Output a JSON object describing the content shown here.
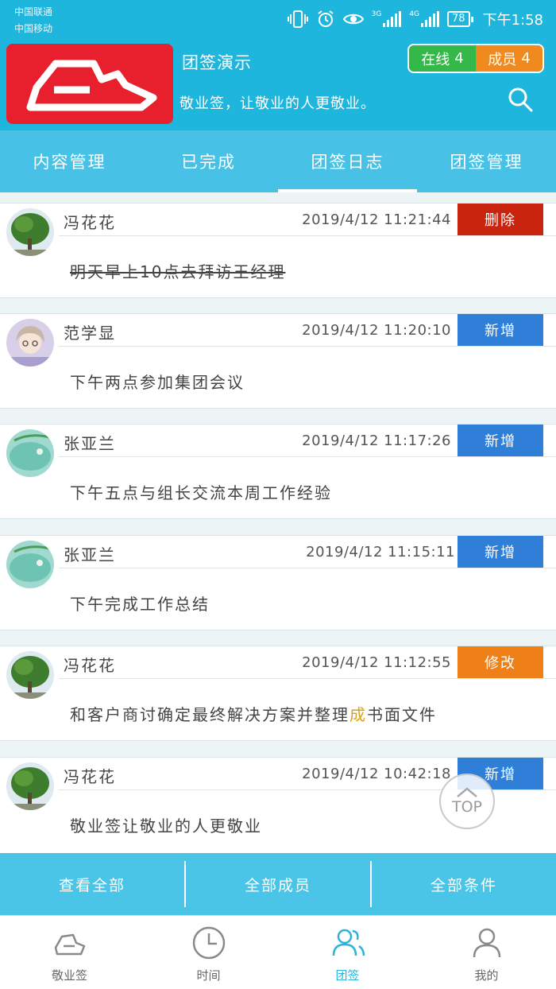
{
  "statusbar": {
    "carrier1": "中国联通",
    "carrier2": "中国移动",
    "net1": "3G",
    "net2": "4G",
    "battery": "78",
    "time": "下午1:58"
  },
  "header": {
    "title": "团签演示",
    "subtitle": "敬业签，让敬业的人更敬业。",
    "online_label": "在线",
    "online_count": "4",
    "members_label": "成员",
    "members_count": "4"
  },
  "tabs": [
    "内容管理",
    "已完成",
    "团签日志",
    "团签管理"
  ],
  "active_tab": 2,
  "items": [
    {
      "user": "冯花花",
      "time": "2019/4/12  11:21:44",
      "action": "删除",
      "action_type": "del",
      "content": "明天早上10点去拜访王经理",
      "avatar": "tree"
    },
    {
      "user": "范学显",
      "time": "2019/4/12  11:20:10",
      "action": "新增",
      "action_type": "add",
      "content": "下午两点参加集团会议",
      "avatar": "anime"
    },
    {
      "user": "张亚兰",
      "time": "2019/4/12  11:17:26",
      "action": "新增",
      "action_type": "add",
      "content": "下午五点与组长交流本周工作经验",
      "avatar": "water"
    },
    {
      "user": "张亚兰",
      "time": "2019/4/12  11:15:11",
      "action": "新增",
      "action_type": "add",
      "content": "下午完成工作总结",
      "avatar": "water"
    },
    {
      "user": "冯花花",
      "time": "2019/4/12  11:12:55",
      "action": "修改",
      "action_type": "mod",
      "content_before": "和客户商讨确定最终解决方案并整理",
      "content_highlight": "成",
      "content_after": "书面文件",
      "avatar": "tree"
    },
    {
      "user": "冯花花",
      "time": "2019/4/12  10:42:18",
      "action": "新增",
      "action_type": "add",
      "content": "敬业签让敬业的人更敬业",
      "avatar": "tree"
    }
  ],
  "top_button": "TOP",
  "actions": [
    "查看全部",
    "全部成员",
    "全部条件"
  ],
  "nav": [
    {
      "label": "敬业签",
      "icon": "app-logo-icon"
    },
    {
      "label": "时间",
      "icon": "clock-icon"
    },
    {
      "label": "团签",
      "icon": "team-icon"
    },
    {
      "label": "我的",
      "icon": "user-icon"
    }
  ],
  "active_nav": 2,
  "colors": {
    "primary": "#1fb6de",
    "delete": "#c9240e",
    "add": "#2f7fd9",
    "modify": "#ef7f17",
    "online": "#35b84a",
    "members": "#f08a1e"
  }
}
